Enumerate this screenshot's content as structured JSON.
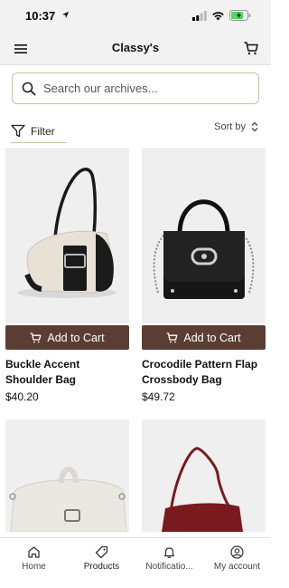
{
  "status_bar": {
    "time": "10:37"
  },
  "header": {
    "title": "Classy's"
  },
  "search": {
    "placeholder": "Search our archives..."
  },
  "toolbar": {
    "filter_label": "Filter",
    "sort_label": "Sort by"
  },
  "products": [
    {
      "name": "Buckle Accent Shoulder Bag",
      "price": "$40.20",
      "add_label": "Add to Cart"
    },
    {
      "name": "Crocodile Pattern Flap Crossbody Bag",
      "price": "$49.72",
      "add_label": "Add to Cart"
    }
  ],
  "bottom_nav": [
    {
      "label": "Home",
      "icon": "home-icon"
    },
    {
      "label": "Products",
      "icon": "tag-icon"
    },
    {
      "label": "Notificatio...",
      "icon": "bell-icon"
    },
    {
      "label": "My account",
      "icon": "user-icon"
    }
  ],
  "colors": {
    "accent": "#5a3e33",
    "search_border": "#c9c2a8",
    "header_bg": "#f2f2f2"
  }
}
